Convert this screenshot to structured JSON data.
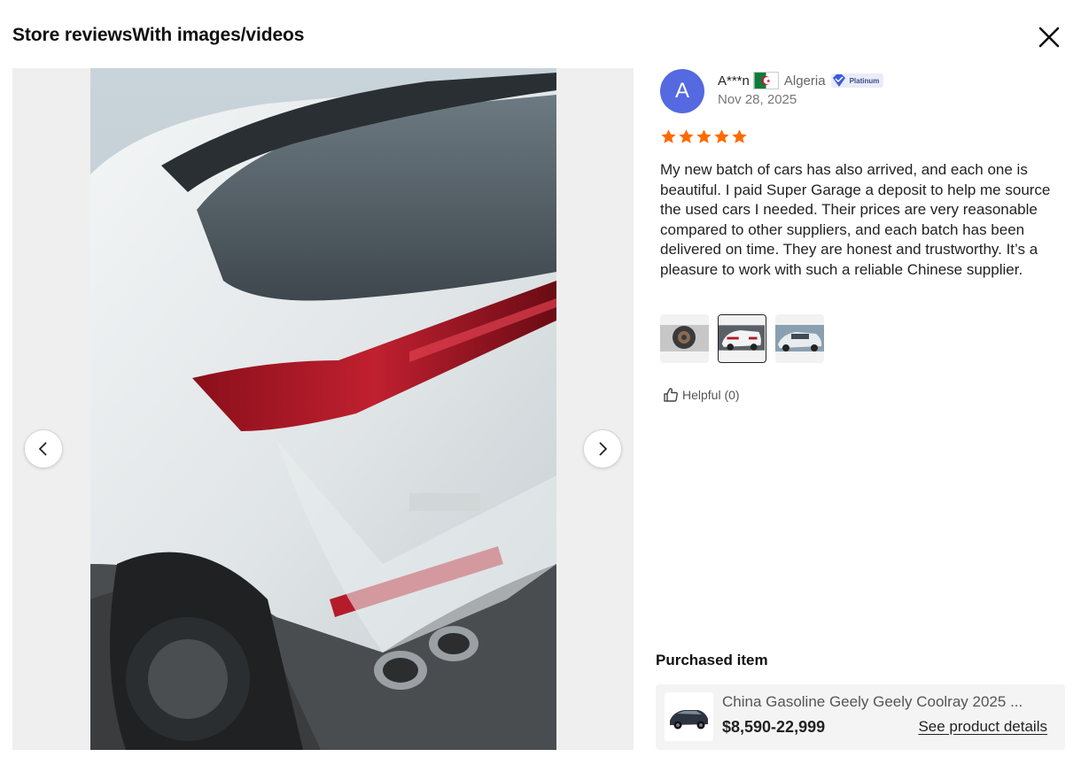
{
  "modal": {
    "title": "Store reviewsWith images/videos",
    "close_icon": "close-icon"
  },
  "review": {
    "avatar_letter": "A",
    "username": "A***n",
    "country": "Algeria",
    "badge_label": "Platinum",
    "date": "Nov 28, 2025",
    "rating": 5,
    "text": "My new batch of cars has also arrived, and each one is beautiful. I paid Super Garage a deposit to help me source the used cars I needed. Their prices are very reasonable compared to other suppliers, and each batch has been delivered on time. They are honest and trustworthy. It’s a pleasure to work with such a reliable Chinese supplier.",
    "helpful_label": "Helpful (0)",
    "thumbnails": [
      "wheel-photo",
      "white-suv-rear-photo",
      "suv-front-photo"
    ],
    "active_thumbnail": 1
  },
  "purchased": {
    "title": "Purchased item",
    "name": "China Gasoline Geely Geely Coolray 2025 ...",
    "price": "$8,590-22,999",
    "link": "See product details"
  },
  "colors": {
    "avatar": "#5569e0",
    "stars": "#ff6a00",
    "badge_bg": "#e9ecf8"
  }
}
